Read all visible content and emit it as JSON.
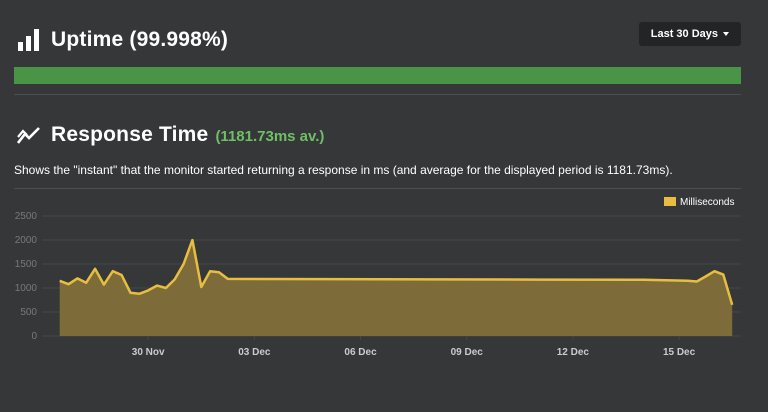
{
  "uptime": {
    "title": "Uptime (99.998%)",
    "range_label": "Last 30 Days",
    "bar_color": "#4a9447",
    "uptime_percent": 99.998
  },
  "response": {
    "title": "Response Time",
    "average": "(1181.73ms av.)",
    "description": "Shows the \"instant\" that the monitor started returning a response in ms (and average for the displayed period is 1181.73ms)."
  },
  "chart_data": {
    "type": "area",
    "legend": "Milliseconds",
    "legend_position": "top-right",
    "y_ticks": [
      "0",
      "500",
      "1000",
      "1500",
      "2000",
      "2500"
    ],
    "ylim": [
      0,
      2500
    ],
    "x_tick_labels": [
      {
        "label": "30 Nov",
        "date": "2023-11-30"
      },
      {
        "label": "03 Dec",
        "date": "2023-12-03"
      },
      {
        "label": "06 Dec",
        "date": "2023-12-06"
      },
      {
        "label": "09 Dec",
        "date": "2023-12-09"
      },
      {
        "label": "12 Dec",
        "date": "2023-12-12"
      },
      {
        "label": "15 Dec",
        "date": "2023-12-15"
      }
    ],
    "grid": true,
    "line_color": "#e8be41",
    "fill_color": "#7d6c3a",
    "points": [
      {
        "t": "2023-11-27T12:00",
        "v": 1150
      },
      {
        "t": "2023-11-27T18:00",
        "v": 1080
      },
      {
        "t": "2023-11-28T00:00",
        "v": 1200
      },
      {
        "t": "2023-11-28T06:00",
        "v": 1110
      },
      {
        "t": "2023-11-28T12:00",
        "v": 1400
      },
      {
        "t": "2023-11-28T18:00",
        "v": 1070
      },
      {
        "t": "2023-11-29T00:00",
        "v": 1350
      },
      {
        "t": "2023-11-29T06:00",
        "v": 1270
      },
      {
        "t": "2023-11-29T12:00",
        "v": 900
      },
      {
        "t": "2023-11-29T18:00",
        "v": 880
      },
      {
        "t": "2023-11-30T00:00",
        "v": 950
      },
      {
        "t": "2023-11-30T06:00",
        "v": 1050
      },
      {
        "t": "2023-11-30T12:00",
        "v": 1000
      },
      {
        "t": "2023-11-30T18:00",
        "v": 1180
      },
      {
        "t": "2023-12-01T00:00",
        "v": 1500
      },
      {
        "t": "2023-12-01T06:00",
        "v": 2000
      },
      {
        "t": "2023-12-01T12:00",
        "v": 1020
      },
      {
        "t": "2023-12-01T18:00",
        "v": 1350
      },
      {
        "t": "2023-12-02T00:00",
        "v": 1330
      },
      {
        "t": "2023-12-02T06:00",
        "v": 1190
      },
      {
        "t": "2023-12-05T00:00",
        "v": 1185
      },
      {
        "t": "2023-12-08T00:00",
        "v": 1180
      },
      {
        "t": "2023-12-11T00:00",
        "v": 1175
      },
      {
        "t": "2023-12-14T00:00",
        "v": 1170
      },
      {
        "t": "2023-12-15T06:00",
        "v": 1150
      },
      {
        "t": "2023-12-15T12:00",
        "v": 1135
      },
      {
        "t": "2023-12-15T18:00",
        "v": 1240
      },
      {
        "t": "2023-12-16T00:00",
        "v": 1350
      },
      {
        "t": "2023-12-16T06:00",
        "v": 1280
      },
      {
        "t": "2023-12-16T12:00",
        "v": 650
      }
    ]
  }
}
